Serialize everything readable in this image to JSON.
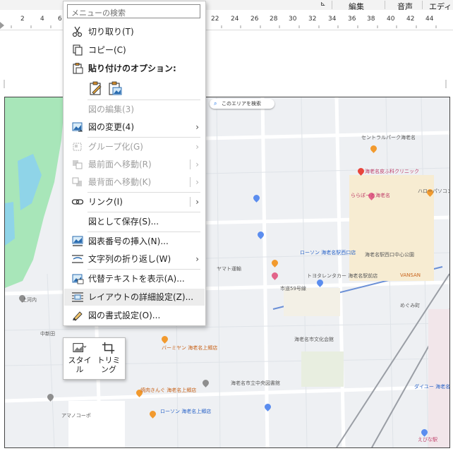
{
  "ribbon": {
    "groups": [
      "編集",
      "音声",
      "エディタ"
    ]
  },
  "ruler": {
    "numbers": [
      "2",
      "4",
      "6",
      "22",
      "24",
      "26",
      "28",
      "30",
      "32",
      "34",
      "36",
      "38",
      "40",
      "42",
      "44"
    ]
  },
  "map": {
    "search_label": "このエリアを検索",
    "labels": {
      "l1": "セントラルパーク海老名",
      "l2": "海老名総合病院",
      "l3": "海老名皮ふ科クリニック",
      "l4": "ららぽーと海老名",
      "l5": "ハローパソコン教室",
      "l6": "ローソン 海老名駅西口店",
      "l7": "海老名駅西口中心公園",
      "l8": "トヨタレンタカー 海老名駅前店",
      "l9": "VANSAN",
      "l10": "めぐみ町",
      "l11": "市道59号線",
      "l12": "海老名市文化会館",
      "l13": "バーミヤン 海老名上郷店",
      "l14": "焼肉きんぐ 海老名上郷店",
      "l15": "ローソン 海老名上郷店",
      "l16": "海老名市立中央図書館",
      "l17": "ダイユー 海老名店",
      "l18": "えびな駅",
      "l19": "海老名市役所",
      "l20": "上河内",
      "l21": "ヤマト運輸",
      "l22": "中新田",
      "l23": "相模川",
      "l24": "アマノコーポ"
    }
  },
  "context_menu": {
    "search_placeholder": "メニューの検索",
    "cut": "切り取り(T)",
    "copy": "コピー(C)",
    "paste_options": "貼り付けのオプション:",
    "edit_picture": "図の編集(3)",
    "change_picture": "図の変更(4)",
    "group": "グループ化(G)",
    "bring_front": "最前面へ移動(R)",
    "send_back": "最背面へ移動(K)",
    "link": "リンク(I)",
    "save_as_picture": "図として保存(S)...",
    "insert_caption": "図表番号の挿入(N)...",
    "wrap_text": "文字列の折り返し(W)",
    "alt_text": "代替テキストを表示(A)...",
    "layout_settings": "レイアウトの詳細設定(Z)...",
    "format_picture": "図の書式設定(O)..."
  },
  "mini_toolbar": {
    "style": "スタイル",
    "crop": "トリミング"
  },
  "colors": {
    "map_bg": "#eef0f3",
    "park_green": "#a8e6b9",
    "road": "#ffffff",
    "accent_blue": "#1a73e8"
  }
}
